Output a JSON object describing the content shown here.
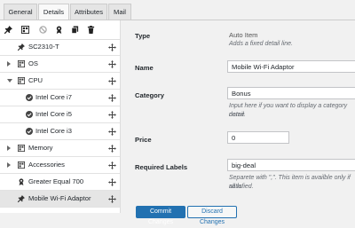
{
  "tabs": [
    {
      "label": "General"
    },
    {
      "label": "Details",
      "active": true
    },
    {
      "label": "Attributes"
    },
    {
      "label": "Mail"
    }
  ],
  "toolbar": {
    "icons": [
      "pin-icon",
      "grid-icon",
      "ban-icon",
      "award-icon",
      "copy-icon",
      "trash-icon"
    ]
  },
  "tree": [
    {
      "label": "SC2310-T",
      "icon": "pin-icon",
      "expandable": false
    },
    {
      "label": "OS",
      "icon": "grid-icon",
      "expandable": true,
      "expanded": false
    },
    {
      "label": "CPU",
      "icon": "grid-icon",
      "expandable": true,
      "expanded": true
    },
    {
      "label": "Intel Core i7",
      "icon": "check-circle-icon",
      "expandable": false
    },
    {
      "label": "Intel Core i5",
      "icon": "check-circle-icon",
      "expandable": false
    },
    {
      "label": "Intel Core i3",
      "icon": "check-circle-icon",
      "expandable": false
    },
    {
      "label": "Memory",
      "icon": "grid-icon",
      "expandable": true,
      "expanded": false
    },
    {
      "label": "Accessories",
      "icon": "grid-icon",
      "expandable": true,
      "expanded": false
    },
    {
      "label": "Greater Equal 700",
      "icon": "award-icon",
      "expandable": false
    },
    {
      "label": "Mobile Wi-Fi Adaptor",
      "icon": "pin-icon",
      "expandable": false,
      "selected": true
    }
  ],
  "form": {
    "type_label": "Type",
    "type_value": "Auto Item",
    "type_desc": "Adds a fixed detail line.",
    "name_label": "Name",
    "name_value": "Mobile Wi-Fi Adaptor",
    "category_label": "Category",
    "category_value": "Bonus",
    "category_desc_1": "Input here if you want to display a category name",
    "category_desc_2": "detail.",
    "price_label": "Price",
    "price_value": "0",
    "required_label": "Required Labels",
    "required_value": "big-deal",
    "required_desc_1": "Separete with \",\". This item is availble only if all la",
    "required_desc_2": "satisfied.",
    "commit_label": "Commit Changes",
    "discard_label": "Discard Changes"
  },
  "colors": {
    "accent": "#2271b1",
    "selected_row": "#e5e5e5"
  }
}
